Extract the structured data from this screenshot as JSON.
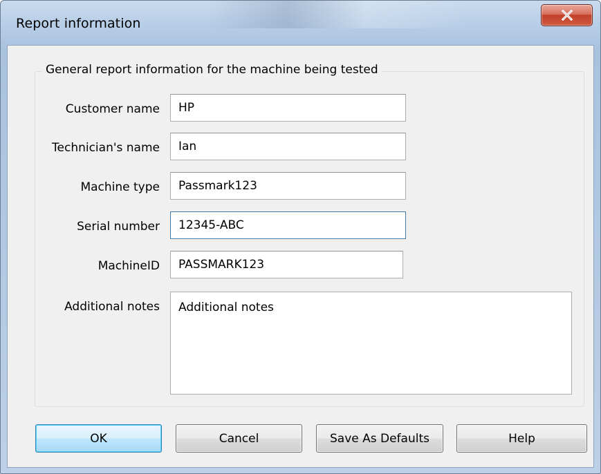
{
  "window": {
    "title": "Report information",
    "close_glyph": "X",
    "close_icon": "close-icon"
  },
  "group": {
    "caption": "General report information for the machine being tested"
  },
  "fields": {
    "customer_name": {
      "label": "Customer name",
      "value": "HP"
    },
    "technician_name": {
      "label": "Technician's name",
      "value": "Ian"
    },
    "machine_type": {
      "label": "Machine type",
      "value": "Passmark123"
    },
    "serial_number": {
      "label": "Serial number",
      "value": "12345-ABC"
    },
    "machine_id": {
      "label": "MachineID",
      "value": "PASSMARK123"
    },
    "additional_notes": {
      "label": "Additional notes",
      "value": "Additional notes"
    }
  },
  "buttons": {
    "ok": "OK",
    "cancel": "Cancel",
    "save_defaults": "Save As Defaults",
    "help": "Help"
  },
  "colors": {
    "frame": "#b5cce6",
    "close_button": "#c2412c",
    "client_background": "#f0f0f0",
    "default_button": "#bee6fd"
  }
}
